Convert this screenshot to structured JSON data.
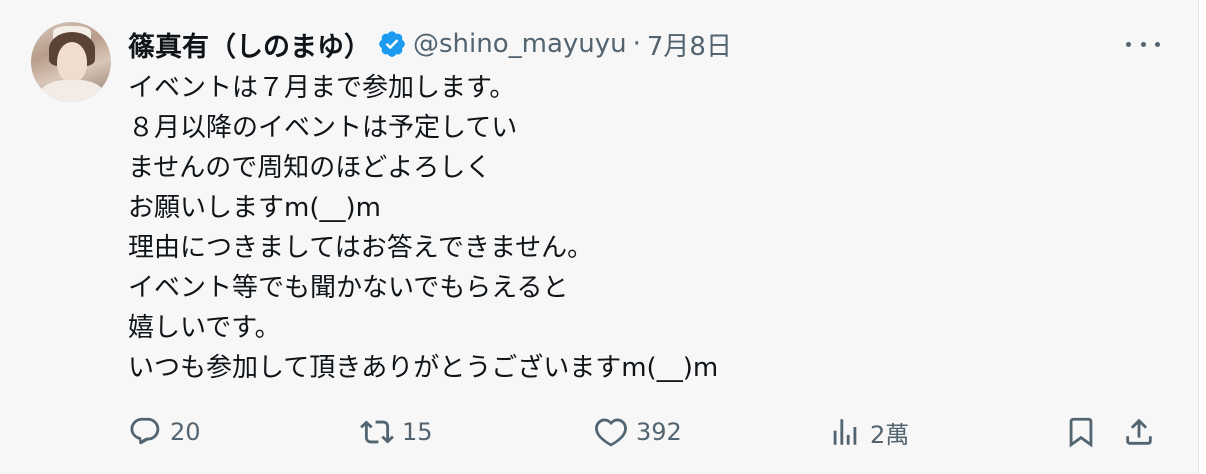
{
  "author": {
    "display_name": "篠真有（しのまゆ）",
    "handle": "@shino_mayuyu",
    "separator": "·",
    "date": "7月8日",
    "verified": true
  },
  "tweet": {
    "lines": [
      "イベントは７月まで参加します。",
      "８月以降のイベントは予定してい",
      "ませんので周知のほどよろしく",
      "お願いしますm(__)m",
      "理由につきましてはお答えできません。",
      "イベント等でも聞かないでもらえると",
      "嬉しいです。",
      "いつも参加して頂きありがとうございますm(__)m"
    ]
  },
  "actions": {
    "replies": "20",
    "retweets": "15",
    "likes": "392",
    "views": "2萬"
  },
  "icons": {
    "avatar": "profile-photo",
    "verified": "verified-badge-icon",
    "more": "more-dots-icon",
    "reply": "reply-icon",
    "retweet": "retweet-icon",
    "like": "heart-icon",
    "views": "analytics-icon",
    "bookmark": "bookmark-icon",
    "share": "share-icon"
  },
  "colors": {
    "verified_blue": "#1d9bf0",
    "muted_gray": "#536471",
    "text": "#0f1419"
  }
}
